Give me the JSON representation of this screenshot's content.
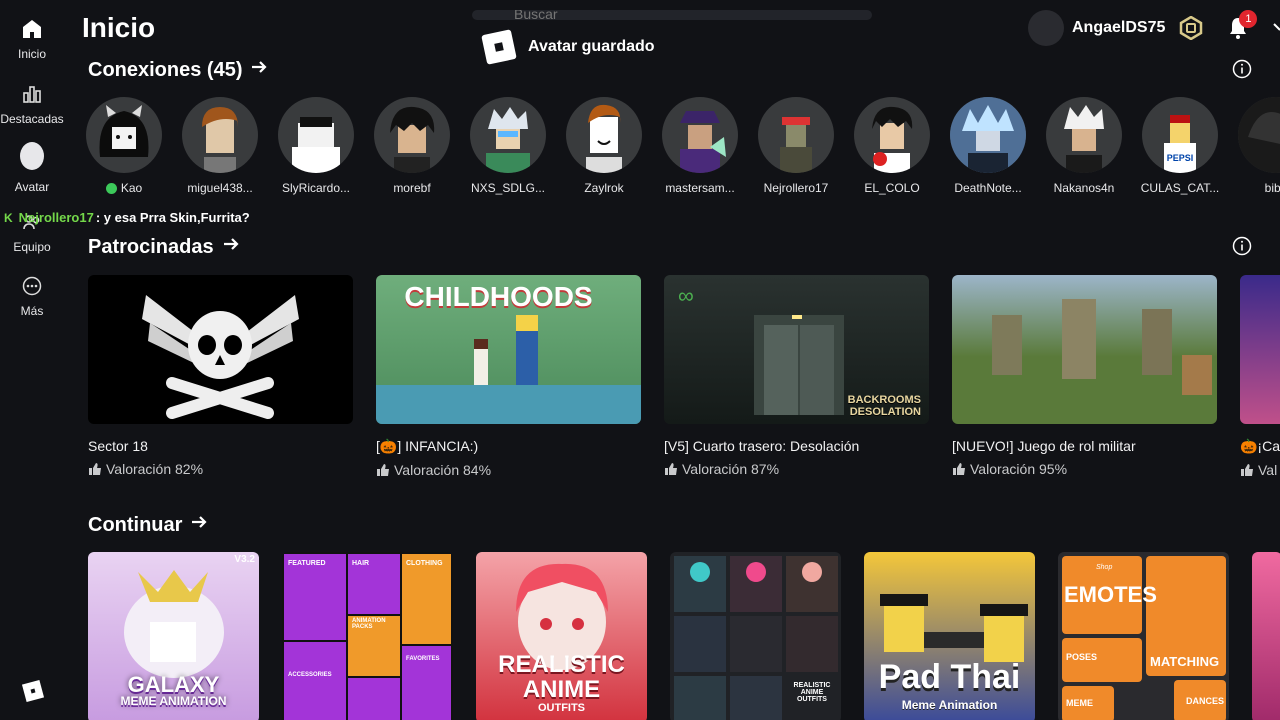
{
  "sidebar": {
    "items": [
      {
        "label": "Inicio",
        "icon": "home-icon"
      },
      {
        "label": "Destacadas",
        "icon": "chart-icon"
      },
      {
        "label": "Avatar",
        "icon": "avatar-icon"
      },
      {
        "label": "Equipo",
        "icon": "group-icon"
      },
      {
        "label": "Más",
        "icon": "more-icon"
      }
    ]
  },
  "header": {
    "title": "Inicio",
    "search_placeholder": "Buscar",
    "toast": "Avatar guardado",
    "username": "AngaelDS75",
    "notification_count": "1"
  },
  "friends_section": {
    "title": "Conexiones (45)",
    "friends": [
      {
        "name": "Kao",
        "online": true
      },
      {
        "name": "miguel438..."
      },
      {
        "name": "SlyRicardo..."
      },
      {
        "name": "morebf"
      },
      {
        "name": "NXS_SDLG..."
      },
      {
        "name": "Zaylrok"
      },
      {
        "name": "mastersam..."
      },
      {
        "name": "Nejrollero17"
      },
      {
        "name": "EL_COLO"
      },
      {
        "name": "DeathNote..."
      },
      {
        "name": "Nakanos4n"
      },
      {
        "name": "CULAS_CAT..."
      },
      {
        "name": "bibo"
      }
    ]
  },
  "chat": {
    "user": "Nejrollero17",
    "message": ": y esa Prra Skin,Furrita?"
  },
  "sponsored": {
    "title": "Patrocinadas",
    "games": [
      {
        "title": "Sector 18",
        "rating": "Valoración 82%"
      },
      {
        "title": "[🎃] INFANCIA:)",
        "rating": "Valoración 84%",
        "thumb_text": "CHILDHOODS"
      },
      {
        "title": "[V5] Cuarto trasero: Desolación",
        "rating": "Valoración 87%",
        "thumb_text": "BACKROOMS DESOLATION"
      },
      {
        "title": "[NUEVO!] Juego de rol militar",
        "rating": "Valoración 95%"
      },
      {
        "title": "🎃¡Ca",
        "rating": "Val"
      }
    ]
  },
  "continue": {
    "title": "Continuar",
    "items": [
      {
        "label": "GALAXY",
        "sub": "MEME ANIMATION",
        "version": "V3.2"
      },
      {
        "labels": [
          "FEATURED",
          "HAIR",
          "CLOTHING",
          "ANIMATION PACKS",
          "ACCESSORIES",
          "FAVORITES"
        ]
      },
      {
        "label": "REALISTIC ANIME",
        "sub": "OUTFITS"
      },
      {
        "label": "REALISTIC ANIME OUTFITS"
      },
      {
        "label": "Pad Thai",
        "sub": "Meme Animation"
      },
      {
        "label": "EMOTES",
        "labels": [
          "Shop",
          "POSES",
          "MATCHING",
          "MEME",
          "DANCES"
        ]
      }
    ]
  },
  "colors": {
    "background": "#111216",
    "online": "#3cc95a",
    "badge": "#e1252e",
    "chat_user": "#74d84a"
  }
}
